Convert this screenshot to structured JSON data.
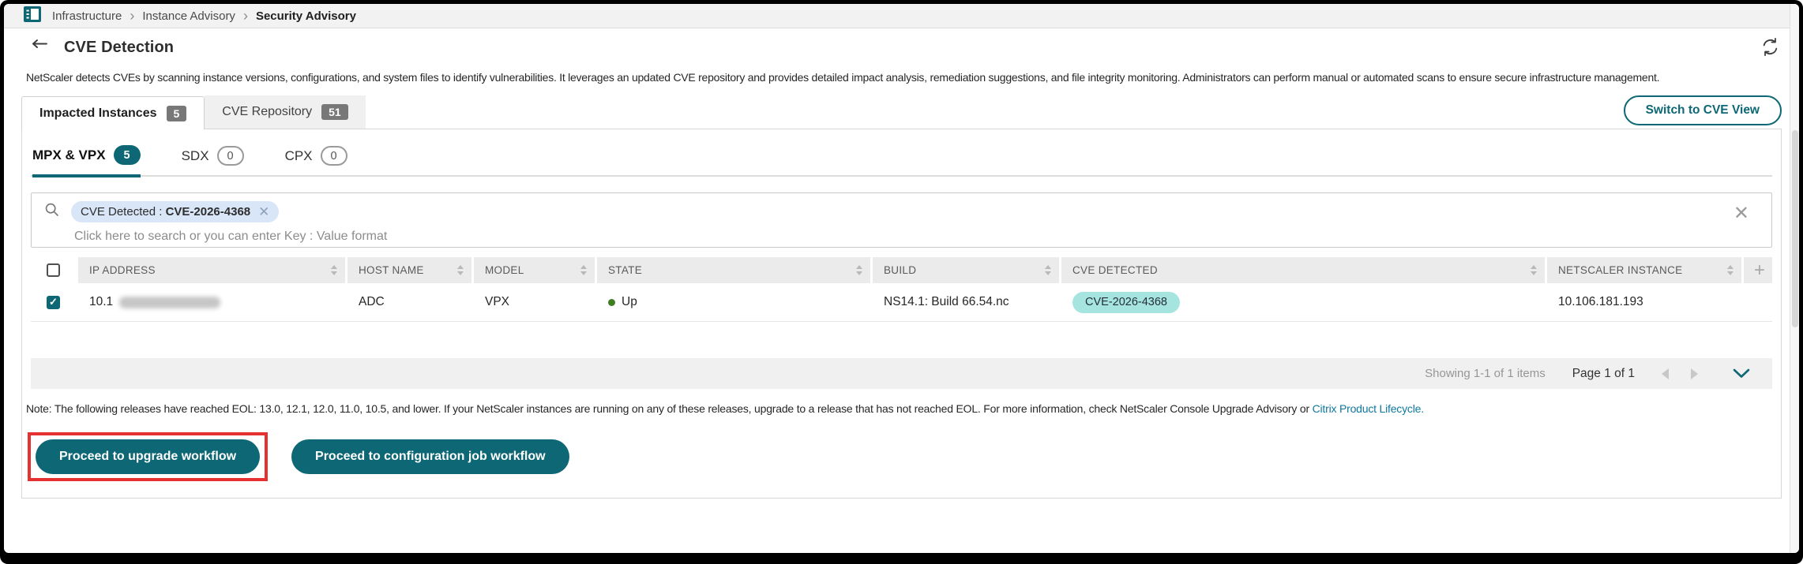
{
  "breadcrumb": {
    "separator": "›",
    "items": [
      {
        "label": "Infrastructure"
      },
      {
        "label": "Instance Advisory"
      },
      {
        "label": "Security Advisory"
      }
    ]
  },
  "header": {
    "title": "CVE Detection",
    "description": "NetScaler detects CVEs by scanning instance versions, configurations, and system files to identify vulnerabilities. It leverages an updated CVE repository and provides detailed impact analysis, remediation suggestions, and file integrity monitoring. Administrators can perform manual or automated scans to ensure secure infrastructure management."
  },
  "tabs": {
    "impacted": {
      "label": "Impacted Instances",
      "count": "5"
    },
    "repository": {
      "label": "CVE Repository",
      "count": "51"
    }
  },
  "switch_view_button": "Switch to CVE View",
  "subtabs": {
    "mpx": {
      "label": "MPX & VPX",
      "count": "5"
    },
    "sdx": {
      "label": "SDX",
      "count": "0"
    },
    "cpx": {
      "label": "CPX",
      "count": "0"
    }
  },
  "search": {
    "chip_key": "CVE Detected : ",
    "chip_value": "CVE-2026-4368",
    "placeholder": "Click here to search or you can enter Key : Value format"
  },
  "table": {
    "columns": [
      "IP ADDRESS",
      "HOST NAME",
      "MODEL",
      "STATE",
      "BUILD",
      "CVE DETECTED",
      "NETSCALER INSTANCE"
    ],
    "add_column_label": "+",
    "row": {
      "ip_visible": "10.1",
      "host_name": "ADC",
      "model": "VPX",
      "state": "Up",
      "build": "NS14.1: Build 66.54.nc",
      "cve_detected": "CVE-2026-4368",
      "netscaler_instance": "10.106.181.193"
    }
  },
  "grid_footer": {
    "showing": "Showing 1-1 of 1 items",
    "page": "Page 1 of 1"
  },
  "note": {
    "text_before_link": "Note: The following releases have reached EOL: 13.0, 12.1, 12.0, 11.0, 10.5, and lower. If your NetScaler instances are running on any of these releases, upgrade to a release that has not reached EOL. For more information, check NetScaler Console Upgrade Advisory or ",
    "link": "Citrix Product Lifecycle."
  },
  "actions": {
    "upgrade_label": "Proceed to upgrade workflow",
    "config_label": "Proceed to configuration job workflow"
  },
  "colors": {
    "primary_teal": "#0d6775",
    "cve_chip_bg": "#a6e4e0",
    "search_chip_bg": "#d9e6f8",
    "highlight_red": "#e5312f",
    "status_up_green": "#3f7d20",
    "badge_gray": "#787878",
    "link_blue": "#0f78a0"
  }
}
